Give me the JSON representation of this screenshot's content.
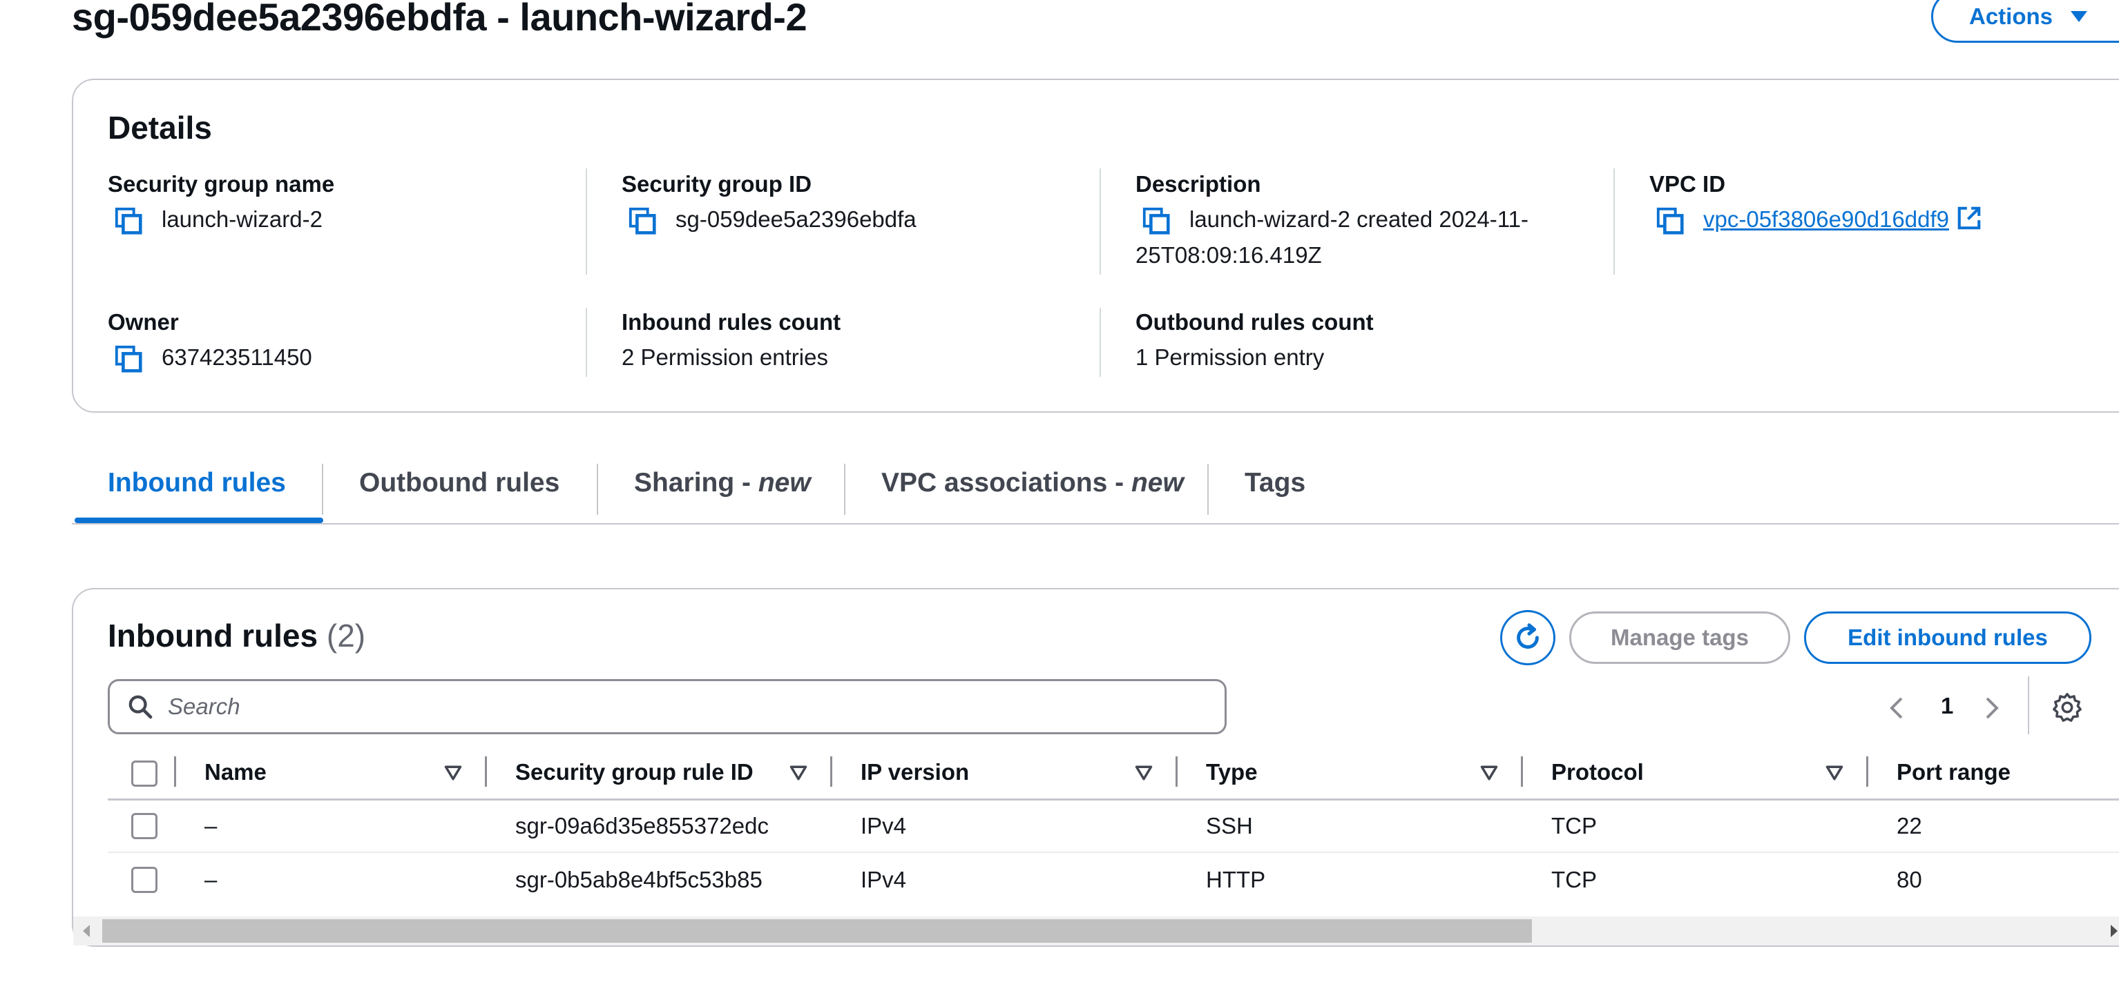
{
  "page_title": "sg-059dee5a2396ebdfa - launch-wizard-2",
  "actions_label": "Actions",
  "details": {
    "heading": "Details",
    "security_group_name": {
      "label": "Security group name",
      "value": "launch-wizard-2"
    },
    "security_group_id": {
      "label": "Security group ID",
      "value": "sg-059dee5a2396ebdfa"
    },
    "description": {
      "label": "Description",
      "value_line1": "launch-wizard-2 created 2024-11-",
      "value_line2": "25T08:09:16.419Z"
    },
    "vpc_id": {
      "label": "VPC ID",
      "value": "vpc-05f3806e90d16ddf9"
    },
    "owner": {
      "label": "Owner",
      "value": "637423511450"
    },
    "inbound_rules_count": {
      "label": "Inbound rules count",
      "value": "2 Permission entries"
    },
    "outbound_rules_count": {
      "label": "Outbound rules count",
      "value": "1 Permission entry"
    }
  },
  "tabs": [
    {
      "label": "Inbound rules",
      "active": true
    },
    {
      "label": "Outbound rules"
    },
    {
      "label": "Sharing - ",
      "suffix": "new"
    },
    {
      "label": "VPC associations - ",
      "suffix": "new"
    },
    {
      "label": "Tags"
    }
  ],
  "inbound": {
    "heading": "Inbound rules",
    "count": "(2)",
    "manage_tags_label": "Manage tags",
    "edit_label": "Edit inbound rules",
    "search_placeholder": "Search",
    "page_number": "1",
    "columns": [
      "Name",
      "Security group rule ID",
      "IP version",
      "Type",
      "Protocol",
      "Port range"
    ],
    "rows": [
      {
        "name": "–",
        "rule_id": "sgr-09a6d35e855372edc",
        "ip_version": "IPv4",
        "type": "SSH",
        "protocol": "TCP",
        "port_range": "22"
      },
      {
        "name": "–",
        "rule_id": "sgr-0b5ab8e4bf5c53b85",
        "ip_version": "IPv4",
        "type": "HTTP",
        "protocol": "TCP",
        "port_range": "80"
      }
    ]
  },
  "colors": {
    "accent": "#0972d3",
    "border": "#c6c6cd",
    "text": "#16191f",
    "disabled": "#8c8c94"
  },
  "icons": [
    "copy-icon",
    "external-link-icon",
    "caret-down-icon",
    "refresh-icon",
    "search-icon",
    "chevron-left-icon",
    "chevron-right-icon",
    "settings-icon",
    "sort-icon"
  ]
}
